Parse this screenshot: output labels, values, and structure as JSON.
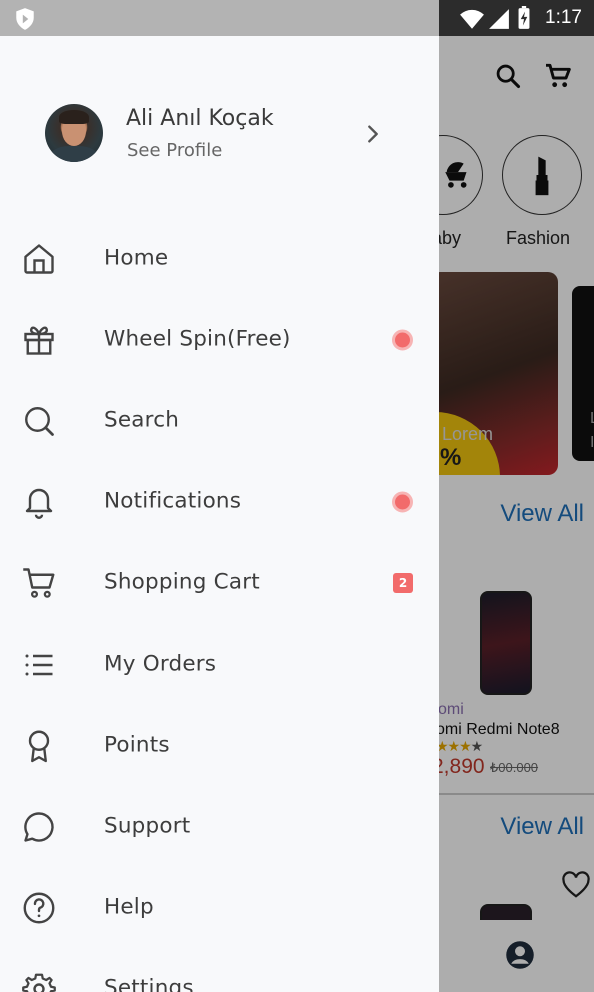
{
  "status_bar": {
    "time": "1:17",
    "icons": [
      "shield-icon",
      "wifi-icon",
      "signal-icon",
      "battery-charging-icon"
    ]
  },
  "background": {
    "header_icons": [
      "search-icon",
      "cart-icon"
    ],
    "categories": [
      {
        "label": "aby",
        "icon": "baby-stroller-icon"
      },
      {
        "label": "Fashion",
        "icon": "lipstick-icon"
      }
    ],
    "banner": {
      "text": "Lorem",
      "percent": "%"
    },
    "banner2_text": [
      "L",
      "I"
    ],
    "view_all_label": "View All",
    "product": {
      "brand": "omi",
      "name": "omi Redmi Note8",
      "price": "2,890",
      "old_price": "₺00.000",
      "rating_stars": 3
    },
    "bottom_icons": [
      "profile-icon"
    ]
  },
  "drawer": {
    "profile": {
      "name": "Ali Anıl Koçak",
      "subtitle": "See Profile"
    },
    "menu": [
      {
        "label": "Home",
        "icon": "home-icon"
      },
      {
        "label": "Wheel Spin(Free)",
        "icon": "gift-icon",
        "indicator": "dot"
      },
      {
        "label": "Search",
        "icon": "search-icon"
      },
      {
        "label": "Notifications",
        "icon": "bell-icon",
        "indicator": "dot"
      },
      {
        "label": "Shopping Cart",
        "icon": "cart-icon",
        "badge": "2"
      },
      {
        "label": "My Orders",
        "icon": "list-icon"
      },
      {
        "label": "Points",
        "icon": "award-icon"
      },
      {
        "label": "Support",
        "icon": "chat-icon"
      },
      {
        "label": "Help",
        "icon": "help-circle-icon"
      },
      {
        "label": "Settings",
        "icon": "settings-icon"
      }
    ]
  },
  "colors": {
    "accent_link": "#1e6fb8",
    "indicator_red": "#f26b6b",
    "drawer_bg": "#f8f9fb",
    "statusbar_dark": "#2c2c2c"
  }
}
